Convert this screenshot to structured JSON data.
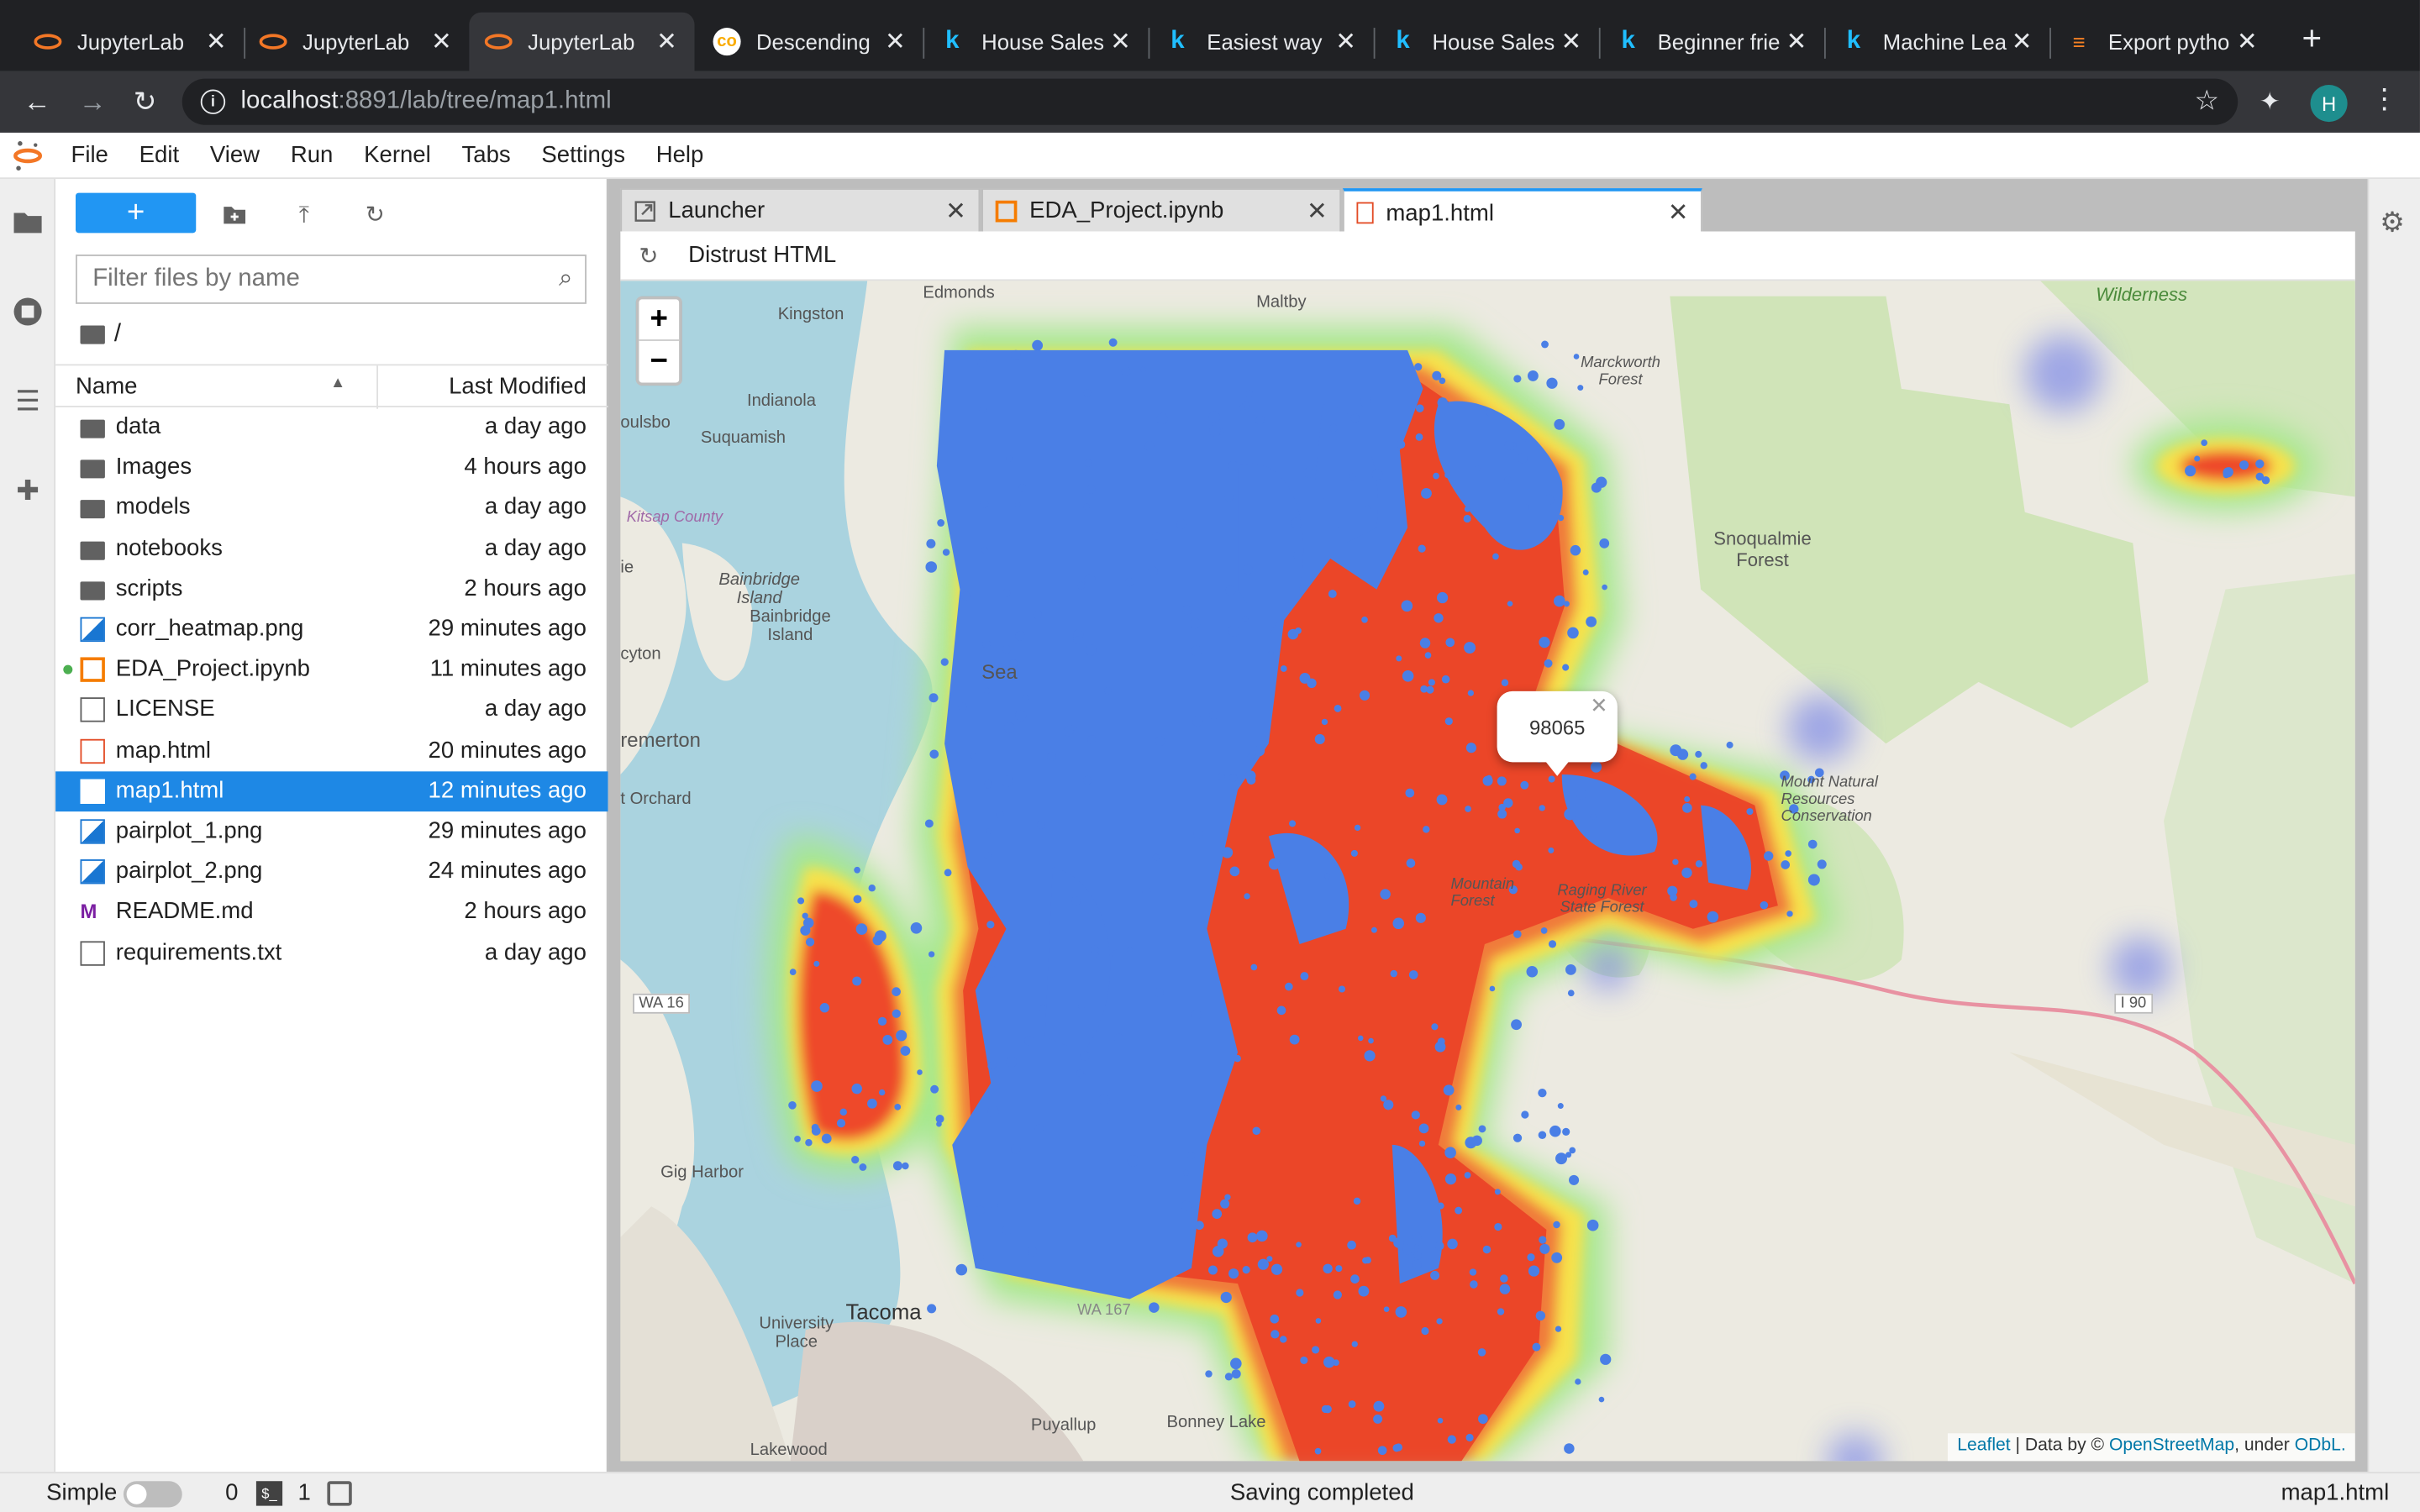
{
  "browser": {
    "tabs": [
      {
        "title": "JupyterLab",
        "icon": "jupyter-icon"
      },
      {
        "title": "JupyterLab",
        "icon": "jupyter-icon"
      },
      {
        "title": "JupyterLab",
        "icon": "jupyter-icon",
        "active": true
      },
      {
        "title": "Descending",
        "icon": "colab-icon"
      },
      {
        "title": "House Sales",
        "icon": "kaggle-icon"
      },
      {
        "title": "Easiest way",
        "icon": "kaggle-icon"
      },
      {
        "title": "House Sales",
        "icon": "kaggle-icon"
      },
      {
        "title": "Beginner frie",
        "icon": "kaggle-icon"
      },
      {
        "title": "Machine Lea",
        "icon": "kaggle-icon"
      },
      {
        "title": "Export pytho",
        "icon": "stackoverflow-icon"
      }
    ],
    "url_host": "localhost",
    "url_rest": ":8891/lab/tree/map1.html",
    "avatar_letter": "H"
  },
  "menubar": [
    "File",
    "Edit",
    "View",
    "Run",
    "Kernel",
    "Tabs",
    "Settings",
    "Help"
  ],
  "filebrowser": {
    "filter_placeholder": "Filter files by name",
    "breadcrumb": "/",
    "col_name": "Name",
    "col_modified": "Last Modified",
    "files": [
      {
        "name": "data",
        "modified": "a day ago",
        "kind": "folder"
      },
      {
        "name": "Images",
        "modified": "4 hours ago",
        "kind": "folder"
      },
      {
        "name": "models",
        "modified": "a day ago",
        "kind": "folder"
      },
      {
        "name": "notebooks",
        "modified": "a day ago",
        "kind": "folder"
      },
      {
        "name": "scripts",
        "modified": "2 hours ago",
        "kind": "folder"
      },
      {
        "name": "corr_heatmap.png",
        "modified": "29 minutes ago",
        "kind": "image"
      },
      {
        "name": "EDA_Project.ipynb",
        "modified": "11 minutes ago",
        "kind": "notebook",
        "running": true
      },
      {
        "name": "LICENSE",
        "modified": "a day ago",
        "kind": "file"
      },
      {
        "name": "map.html",
        "modified": "20 minutes ago",
        "kind": "html"
      },
      {
        "name": "map1.html",
        "modified": "12 minutes ago",
        "kind": "html",
        "selected": true
      },
      {
        "name": "pairplot_1.png",
        "modified": "29 minutes ago",
        "kind": "image"
      },
      {
        "name": "pairplot_2.png",
        "modified": "24 minutes ago",
        "kind": "image"
      },
      {
        "name": "README.md",
        "modified": "2 hours ago",
        "kind": "markdown"
      },
      {
        "name": "requirements.txt",
        "modified": "a day ago",
        "kind": "file"
      }
    ]
  },
  "doc_tabs": [
    {
      "label": "Launcher",
      "icon": "launcher-icon"
    },
    {
      "label": "EDA_Project.ipynb",
      "icon": "notebook-icon"
    },
    {
      "label": "map1.html",
      "icon": "html-icon",
      "active": true
    }
  ],
  "html_toolbar": {
    "trust_label": "Distrust HTML"
  },
  "map": {
    "popup_text": "98065",
    "zoom_in": "+",
    "zoom_out": "−",
    "attribution_leaflet": "Leaflet",
    "attribution_mid": " | Data by © ",
    "attribution_osm": "OpenStreetMap",
    "attribution_under": ", under ",
    "attribution_odbl": "ODbL.",
    "place_labels": [
      "Edmonds",
      "Maltby",
      "Wilderness",
      "Kingston",
      "Indianola",
      "Suquamish",
      "oulsbo",
      "Kitsap County",
      "Bainbridge Island",
      "Bainbridge Island",
      "Snoqualmie Forest",
      "Marckworth Forest",
      "ie",
      "cyton",
      "remerton",
      "t Orchard",
      "Sea",
      "Mount Natural Resources Conservation",
      "Mountain Forest",
      "Raging River State Forest",
      "WA 16",
      "I 90",
      "Gig Harbor",
      "Tacoma",
      "University Place",
      "WA 167",
      "Puyallup",
      "Bonney Lake",
      "Lakewood"
    ]
  },
  "statusbar": {
    "mode": "Simple",
    "kernels": "0",
    "terminals": "1",
    "message": "Saving completed",
    "filename": "map1.html"
  }
}
